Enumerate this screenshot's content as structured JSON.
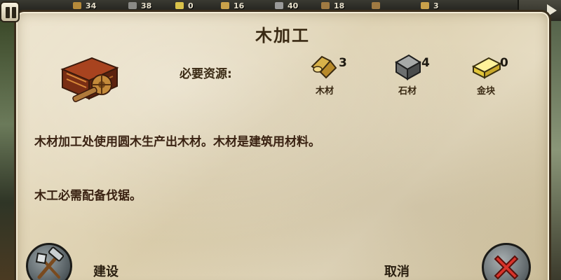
{
  "topbar": {
    "resources": [
      {
        "icon": "wood-icon",
        "value": "34",
        "color": "#b58a3a"
      },
      {
        "icon": "stone-icon",
        "value": "38",
        "color": "#8a8a86"
      },
      {
        "icon": "gold-icon",
        "value": "0",
        "color": "#d9c24a"
      },
      {
        "icon": "food-icon",
        "value": "16",
        "color": "#c9a14a"
      },
      {
        "icon": "iron-icon",
        "value": "40",
        "color": "#9a9a9a"
      },
      {
        "icon": "weapon-icon",
        "value": "18",
        "color": "#a07a42"
      },
      {
        "icon": "tool-icon",
        "value": "",
        "color": "#a07a42"
      },
      {
        "icon": "people-icon",
        "value": "3",
        "color": "#c9a14a"
      }
    ]
  },
  "dialog": {
    "title": "木加工",
    "required_label": "必要资源:",
    "resources": [
      {
        "icon": "wood-log-icon",
        "count": "3",
        "name": "木材"
      },
      {
        "icon": "stone-block-icon",
        "count": "4",
        "name": "石材"
      },
      {
        "icon": "gold-bar-icon",
        "count": "0",
        "name": "金块"
      }
    ],
    "description_1": "木材加工处使用圆木生产出木材。木材是建筑用材料。",
    "description_2": "木工必需配备伐锯。",
    "build_label": "建设",
    "cancel_label": "取消"
  },
  "colors": {
    "parchment": "#e3d8bb",
    "text": "#3a2212",
    "border": "#3a2e1c",
    "cancel_x": "#c8302a",
    "gold": "#f1dc4e"
  }
}
